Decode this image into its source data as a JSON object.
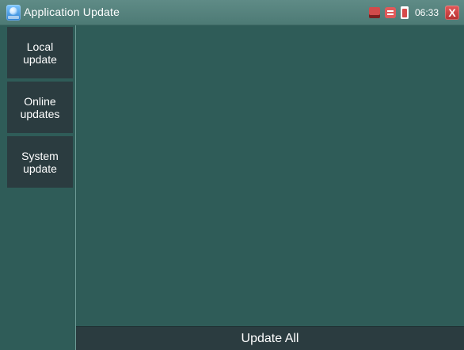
{
  "header": {
    "title": "Application Update",
    "time": "06:33",
    "icons": {
      "app": "app-update-icon",
      "network": "network-icon",
      "swap": "swap-icon",
      "battery": "battery-icon",
      "close": "close-icon"
    },
    "close_label": "X"
  },
  "sidebar": {
    "items": [
      {
        "label": "Local\nupdate"
      },
      {
        "label": "Online\nupdates"
      },
      {
        "label": "System\nupdate"
      }
    ]
  },
  "main": {
    "update_all_label": "Update All"
  },
  "colors": {
    "background": "#2f5c58",
    "title_bar": "#5f8b86",
    "button_bg": "#2b3c40",
    "accent_red": "#d64b4b"
  }
}
